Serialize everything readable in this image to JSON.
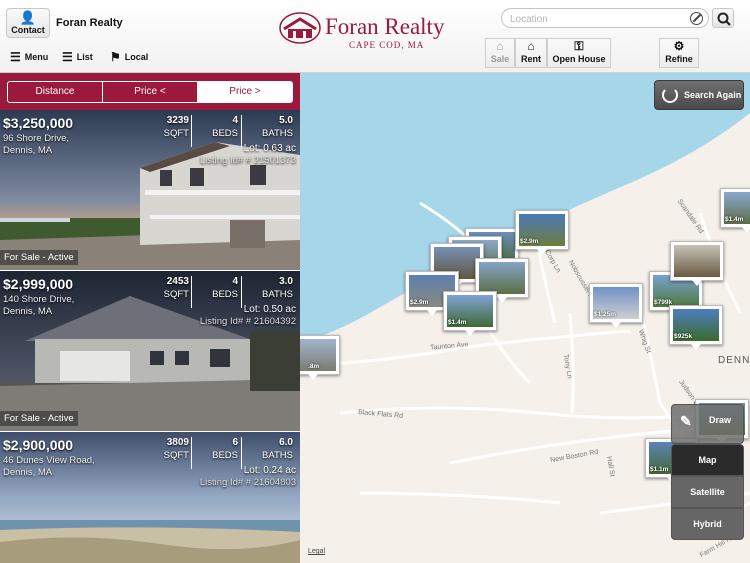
{
  "header": {
    "contact_label": "Contact",
    "company_name": "Foran Realty",
    "nav": {
      "menu": "Menu",
      "list": "List",
      "local": "Local"
    },
    "logo": {
      "name": "Foran Realty",
      "tagline": "CAPE COD, MA"
    },
    "search": {
      "placeholder": "Location",
      "value": ""
    },
    "types": {
      "sale": "Sale",
      "rent": "Rent",
      "open_house": "Open House",
      "refine": "Refine"
    }
  },
  "sort": {
    "options": [
      "Distance",
      "Price <",
      "Price >"
    ],
    "active": "Price >"
  },
  "listings": [
    {
      "price": "$3,250,000",
      "address_line1": "96 Shore Drive,",
      "address_line2": "Dennis, MA",
      "sqft": "3239",
      "sqft_label": "SQFT",
      "beds": "4",
      "beds_label": "BEDS",
      "baths": "5.0",
      "baths_label": "BATHS",
      "lot": "Lot: 0.63 ac",
      "listing_id": "Listing Id# # 21501373",
      "status": "For Sale - Active"
    },
    {
      "price": "$2,999,000",
      "address_line1": "140 Shore Drive,",
      "address_line2": "Dennis, MA",
      "sqft": "2453",
      "sqft_label": "SQFT",
      "beds": "4",
      "beds_label": "BEDS",
      "baths": "3.0",
      "baths_label": "BATHS",
      "lot": "Lot: 0.50 ac",
      "listing_id": "Listing Id# # 21604392",
      "status": "For Sale - Active"
    },
    {
      "price": "$2,900,000",
      "address_line1": "46 Dunes View Road,",
      "address_line2": "Dennis, MA",
      "sqft": "3809",
      "sqft_label": "SQFT",
      "beds": "6",
      "beds_label": "BEDS",
      "baths": "6.0",
      "baths_label": "BATHS",
      "lot": "Lot: 0.24 ac",
      "listing_id": "Listing Id# # 21604803",
      "status": ""
    }
  ],
  "map": {
    "search_again": "Search Again",
    "draw": "Draw",
    "types": [
      "Map",
      "Satellite",
      "Hybrid"
    ],
    "selected_type": "Map",
    "legal": "Legal",
    "water_color": "#a6d6ea",
    "roads": [
      "Taunton Ave",
      "Black Flats Rd",
      "New Boston Rd",
      "Nobscusset Rd",
      "Tony Ln",
      "Whig St",
      "Judson Way",
      "Hall St",
      "Farm Hill Rd",
      "Scandale Rd",
      "Corp Ln"
    ],
    "place_label": "DENNI",
    "pins": [
      "$2.9m",
      "$2.9m",
      "$1.4m",
      "$1.25m",
      "$799k",
      "$925k",
      "$1.4m",
      ".8m",
      "$1.1m"
    ]
  }
}
